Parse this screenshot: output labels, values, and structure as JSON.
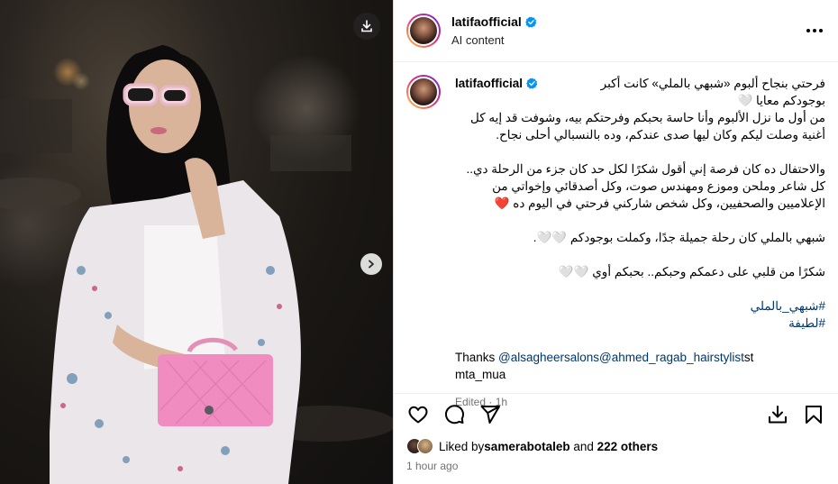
{
  "header": {
    "username": "latifaofficial",
    "subtitle": "AI content"
  },
  "caption": {
    "username": "latifaofficial",
    "first_line": "فرحتي بنجاح ألبوم «شبهي بالملي» كانت أكبر",
    "line2": "بوجودكم معايا 🤍",
    "para1": [
      "من أول ما نزل الألبوم وأنا حاسة بحبكم وفرحتكم بيه، وشوفت قد إيه كل",
      "أغنية وصلت ليكم وكان ليها صدى عندكم، وده بالنسبالي أحلى نجاح."
    ],
    "para2": [
      "والاحتفال ده كان فرصة إني أقول شكرًا لكل حد كان جزء من الرحلة دي..",
      "كل شاعر وملحن وموزع ومهندس صوت، وكل أصدقائي وإخواتي من",
      "الإعلاميين والصحفيين، وكل شخص شاركني فرحتي في اليوم ده ❤️"
    ],
    "para3": "شبهي بالملي كان رحلة جميلة جدًا، وكملت بوجودكم 🤍🤍.",
    "para4": "شكرًا من قلبي على دعمكم وحبكم.. بحبكم أوي 🤍🤍",
    "hashtags": [
      "#شبهي_بالملي",
      "#لطيفة"
    ],
    "thanks_prefix": "Thanks ",
    "mentions": "@alsagheersalons@ahmed_ragab_hairstylist",
    "thanks_suffix": "st",
    "thanks_line2": "mta_mua",
    "edited": "Edited · 1h"
  },
  "likes": {
    "prefix": "Liked by ",
    "user": "samerabotaleb",
    "middle": " and ",
    "others": "222 others"
  },
  "timestamp": "1 hour ago",
  "colors": {
    "link": "#00376b",
    "verified": "#0095f6",
    "muted": "#737373"
  }
}
